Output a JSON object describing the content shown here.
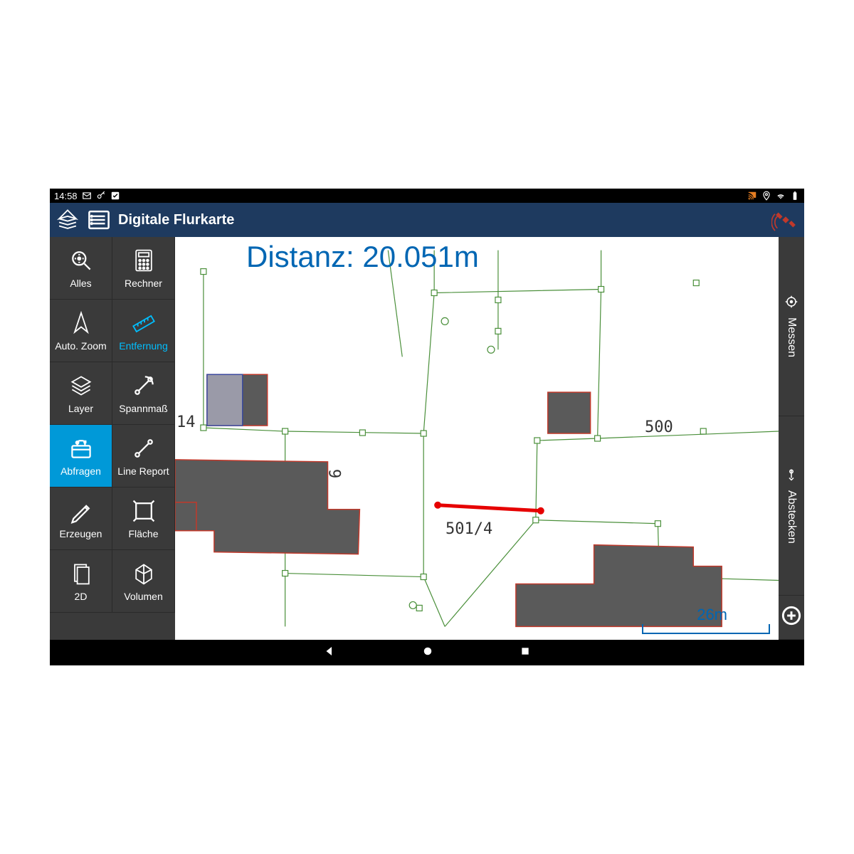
{
  "statusBar": {
    "time": "14:58"
  },
  "header": {
    "title": "Digitale Flurkarte"
  },
  "leftTools": {
    "alles": "Alles",
    "rechner": "Rechner",
    "autoZoom": "Auto. Zoom",
    "entfernung": "Entfernung",
    "layer": "Layer",
    "spannmass": "Spannmaß",
    "abfragen": "Abfragen",
    "lineReport": "Line Report",
    "erzeugen": "Erzeugen",
    "flaeche": "Fläche",
    "zwei_d": "2D",
    "volumen": "Volumen"
  },
  "rightTools": {
    "messen": "Messen",
    "abstecken": "Abstecken"
  },
  "map": {
    "distanceLabel": "Distanz: 20.051m",
    "scaleLabel": "26m",
    "parcels": {
      "p14": "14",
      "p6": "6",
      "p500": "500",
      "p501_4": "501/4"
    }
  },
  "colors": {
    "headerBg": "#1e3a5f",
    "toolbarBg": "#3a3a3a",
    "activeBlue": "#0099d8",
    "accentCyan": "#00bfff",
    "parcelGreen": "#4a8f3a",
    "buildingFill": "#5a5a5a",
    "buildingStroke": "#c0392b",
    "measureRed": "#e60000",
    "scaleBlue": "#0066b3"
  }
}
